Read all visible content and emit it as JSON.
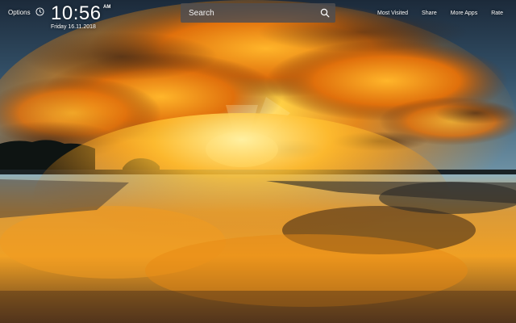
{
  "topbar": {
    "options_label": "Options",
    "clock": {
      "time": "10:56",
      "ampm": "AM",
      "date": "Friday  16.11.2018"
    },
    "search": {
      "placeholder": "Search",
      "icon": "search-icon"
    },
    "links": [
      "Most Visited",
      "Share",
      "More Apps",
      "Rate"
    ]
  },
  "background": {
    "subject": "sunset-over-tidal-flat",
    "colors": {
      "sky_dark": "#27384a",
      "sky_teal": "#5e8a9c",
      "sun_glow": "#ffe27a",
      "cloud_orange": "#f08a12",
      "cloud_dark": "#3a2414"
    }
  }
}
